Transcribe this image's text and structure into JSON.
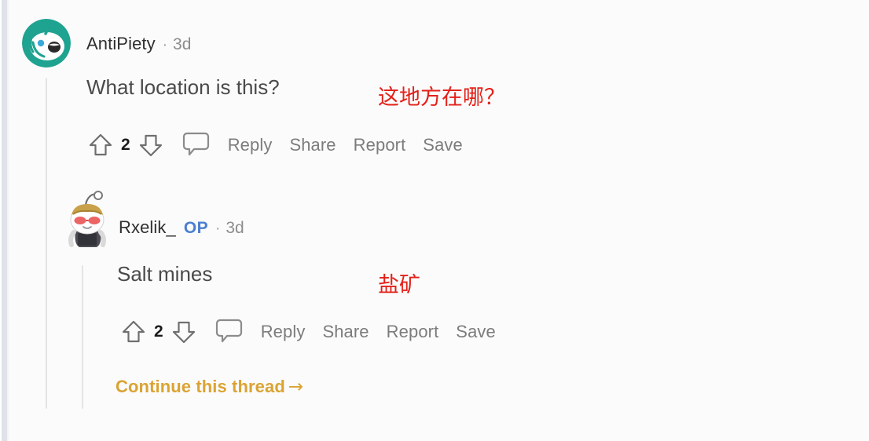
{
  "theme": {
    "background": "#fbfbfb",
    "text_primary": "#4a4a4a",
    "text_muted": "#7c7c7c",
    "gloss_red": "#e32119",
    "op_blue": "#4a7fd0",
    "continue_gold": "#dba333",
    "thread_line": "#e4e4e4",
    "avatar1_teal": "#1ea391"
  },
  "comments": [
    {
      "author": "AntiPiety",
      "is_op": false,
      "op_label": "",
      "separator": "·",
      "age": "3d",
      "body": "What location is this?",
      "gloss": "这地方在哪？",
      "avatar_name": "avatar-antipiety",
      "actions": {
        "score": "2",
        "upvote_name": "upvote-icon",
        "downvote_name": "downvote-icon",
        "comment_icon_name": "comment-bubble-icon",
        "items": [
          "Reply",
          "Share",
          "Report",
          "Save"
        ]
      }
    },
    {
      "author": "Rxelik_",
      "is_op": true,
      "op_label": "OP",
      "separator": "·",
      "age": "3d",
      "body": "Salt mines",
      "gloss": "盐矿",
      "avatar_name": "avatar-rxelik",
      "actions": {
        "score": "2",
        "upvote_name": "upvote-icon",
        "downvote_name": "downvote-icon",
        "comment_icon_name": "comment-bubble-icon",
        "items": [
          "Reply",
          "Share",
          "Report",
          "Save"
        ]
      }
    }
  ],
  "continue_thread": {
    "label": "Continue this thread",
    "arrow": "→"
  }
}
